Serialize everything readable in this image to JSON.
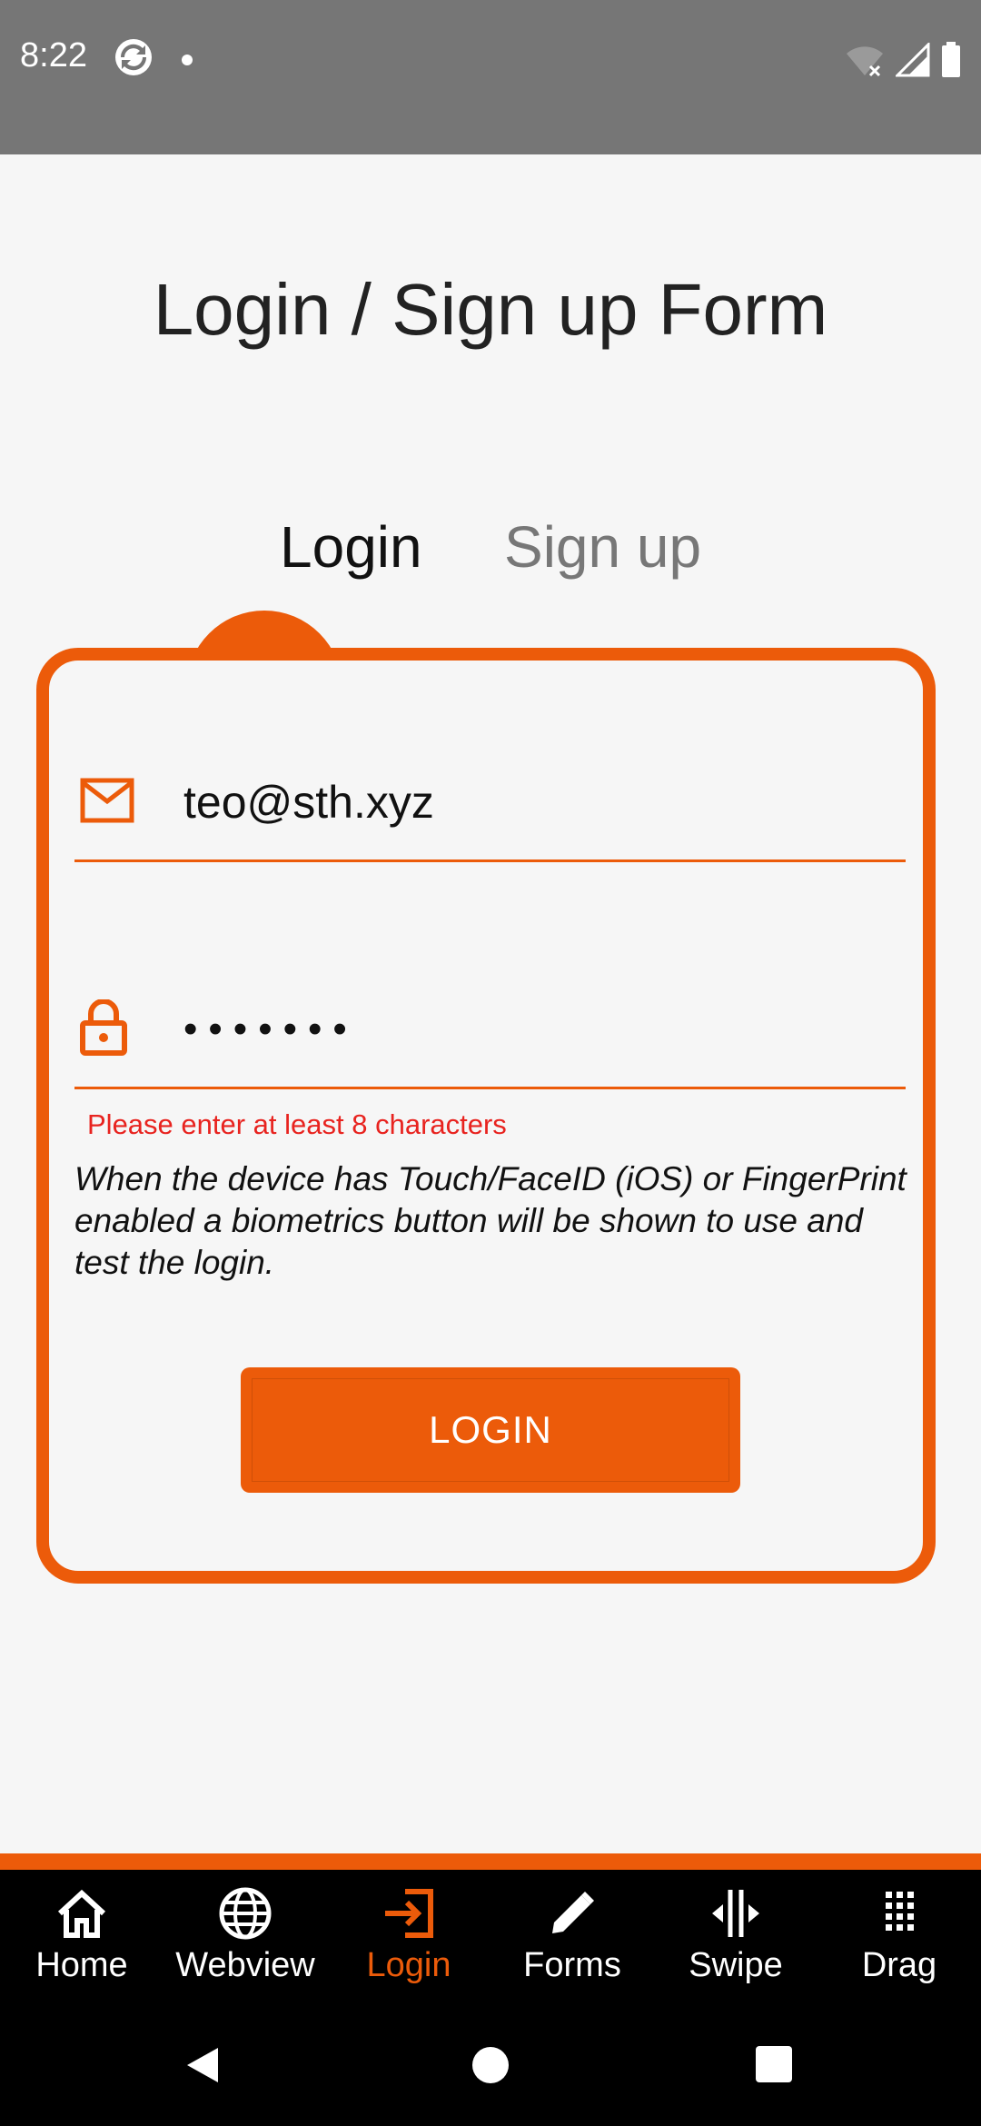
{
  "status_bar": {
    "time": "8:22",
    "icons": [
      "sync-icon",
      "notification-dot-icon",
      "wifi-off-icon",
      "signal-icon",
      "battery-icon"
    ]
  },
  "page": {
    "title": "Login / Sign up Form"
  },
  "tabs": {
    "login_label": "Login",
    "signup_label": "Sign up",
    "active": "Login"
  },
  "form": {
    "email_value": "teo@sth.xyz",
    "password_masked": "•••••••",
    "error_message": "Please enter at least 8 characters",
    "note": "When the device has Touch/FaceID (iOS) or FingerPrint enabled a biometrics button will be shown to use and test the login.",
    "login_button_label": "LOGIN"
  },
  "bottom_nav": {
    "items": [
      {
        "label": "Home",
        "icon": "home-icon"
      },
      {
        "label": "Webview",
        "icon": "globe-icon"
      },
      {
        "label": "Login",
        "icon": "login-icon"
      },
      {
        "label": "Forms",
        "icon": "pencil-icon"
      },
      {
        "label": "Swipe",
        "icon": "swipe-icon"
      },
      {
        "label": "Drag",
        "icon": "grid-icon"
      }
    ],
    "active": "Login"
  },
  "colors": {
    "accent": "#ec5b0a",
    "error": "#e8231f",
    "status_bar": "#767676",
    "background": "#f6f6f6"
  }
}
